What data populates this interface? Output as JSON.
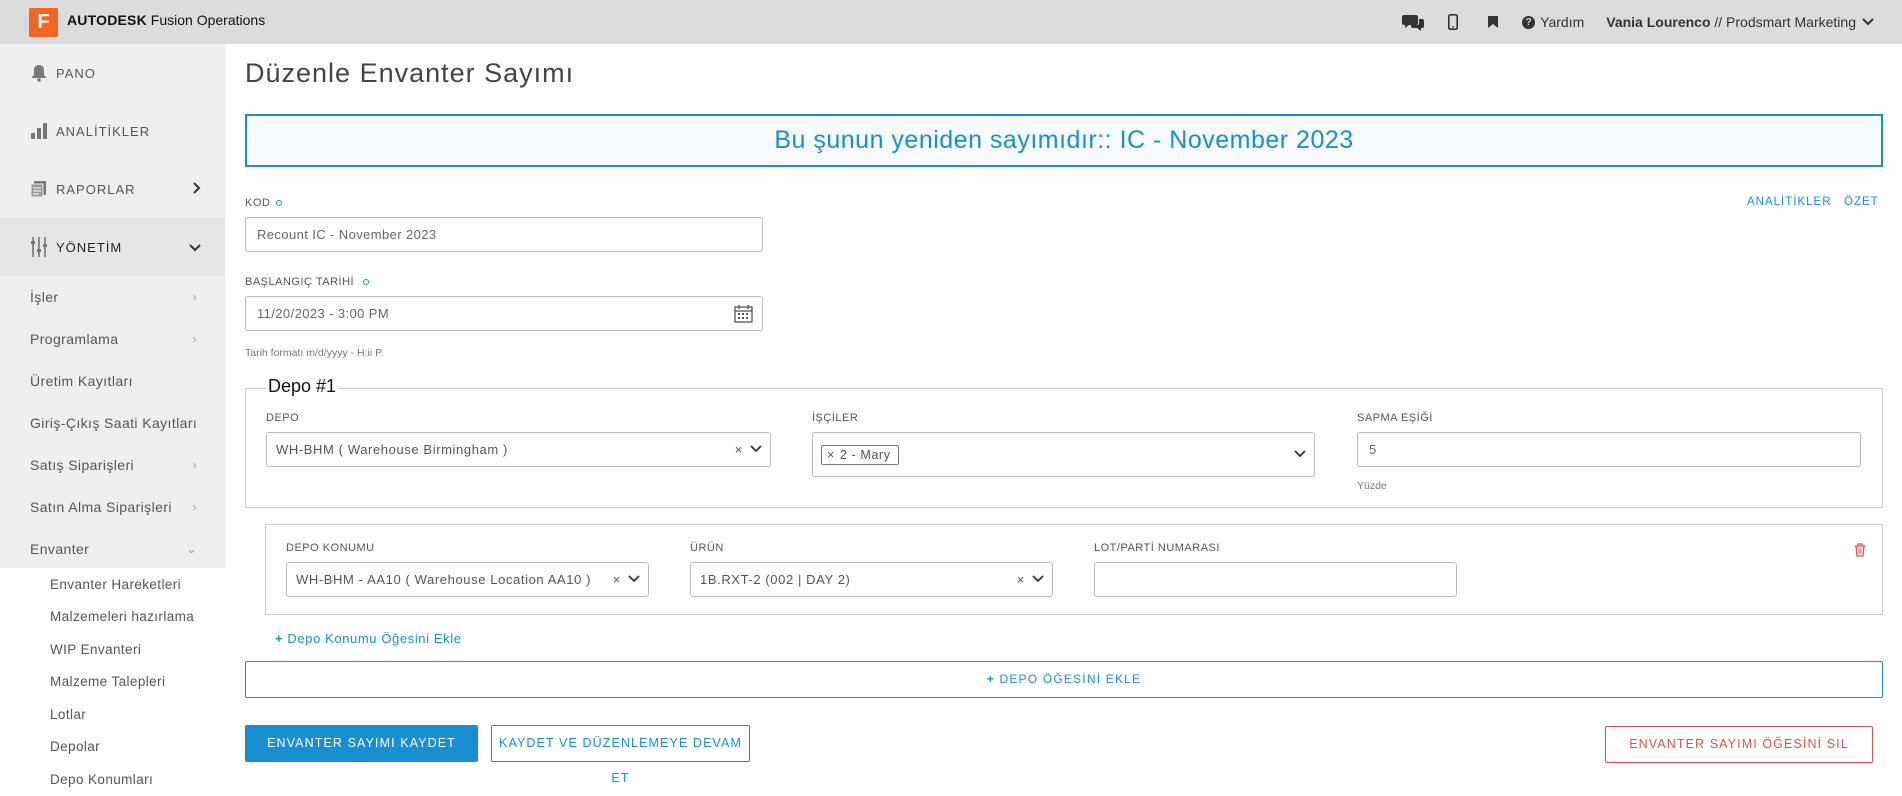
{
  "app": {
    "logo_letter": "F",
    "brand_bold": "AUTODESK",
    "brand_rest": " Fusion Operations",
    "accent": "#1a8fd0",
    "danger": "#d9534f"
  },
  "topbar": {
    "icons": [
      "chat-icon",
      "mobile-icon",
      "bookmark-icon"
    ],
    "help_label": "Yardım",
    "user_name": "Vania Lourenco",
    "user_org": " // Prodsmart Marketing"
  },
  "sidebar": {
    "top": [
      {
        "label": "PANO",
        "icon": "bell-icon"
      },
      {
        "label": "ANALİTİKLER",
        "icon": "bar-chart-icon"
      },
      {
        "label": "RAPORLAR",
        "icon": "report-icon"
      },
      {
        "label": "YÖNETİM",
        "icon": "sliders-icon"
      }
    ],
    "items": [
      {
        "label": "İşler"
      },
      {
        "label": "Programlama"
      },
      {
        "label": "Üretim Kayıtları"
      },
      {
        "label": "Giriş-Çıkış Saati Kayıtları"
      },
      {
        "label": "Satış Siparişleri"
      },
      {
        "label": "Satın Alma Siparişleri"
      },
      {
        "label": "Envanter"
      }
    ],
    "subitems": [
      {
        "label": "Envanter Hareketleri"
      },
      {
        "label": "Malzemeleri hazırlama"
      },
      {
        "label": "WIP Envanteri"
      },
      {
        "label": "Malzeme Talepleri"
      },
      {
        "label": "Lotlar"
      },
      {
        "label": "Depolar"
      },
      {
        "label": "Depo Konumları"
      }
    ]
  },
  "page": {
    "title": "Düzenle Envanter Sayımı",
    "banner": "Bu şunun yeniden sayımıdır:: IC - November 2023",
    "links": {
      "analytics": "ANALİTİKLER",
      "summary": "ÖZET"
    },
    "code": {
      "label": "KOD",
      "value": "Recount IC - November 2023"
    },
    "start_date": {
      "label": "BAŞLANGIÇ TARİHİ",
      "value": "11/20/2023 - 3:00 PM",
      "hint": "Tarih formatı m/d/yyyy - H:ii P."
    },
    "depo_section": {
      "legend": "Depo #1",
      "depo": {
        "label": "DEPO",
        "value": "WH-BHM ( Warehouse Birmingham )"
      },
      "workers": {
        "label": "İŞÇİLER",
        "tag": "2 - Mary"
      },
      "threshold": {
        "label": "SAPMA EŞİĞİ",
        "value": "5",
        "hint": "Yüzde"
      }
    },
    "location_row": {
      "location": {
        "label": "DEPO KONUMU",
        "value": "WH-BHM - AA10 ( Warehouse Location AA10 )"
      },
      "product": {
        "label": "ÜRÜN",
        "value": "1B.RXT-2 (002 | DAY 2)"
      },
      "lot": {
        "label": "LOT/PARTİ NUMARASI",
        "value": ""
      }
    },
    "add_location": "Depo Konumu Öğesini Ekle",
    "add_depo": "DEPO ÖĞESİNİ EKLE",
    "buttons": {
      "save": "ENVANTER SAYIMI KAYDET",
      "save_continue": "KAYDET VE DÜZENLEMEYE DEVAM ET",
      "delete": "ENVANTER SAYIMI ÖĞESİNİ SIL"
    }
  }
}
